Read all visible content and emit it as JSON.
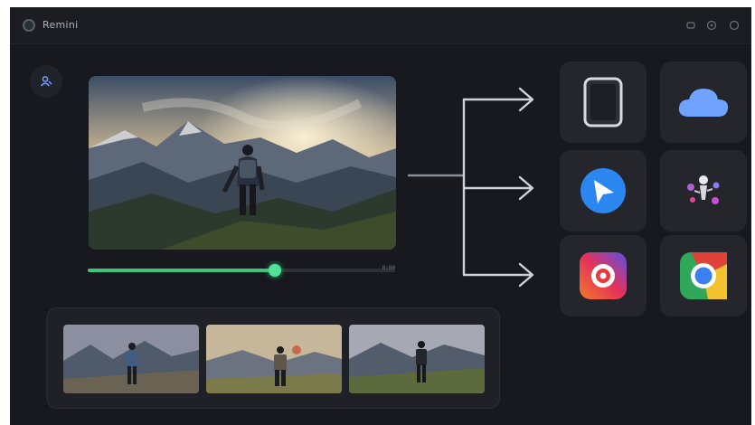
{
  "app": {
    "title": "Remini",
    "logo_icon": "app-logo-icon"
  },
  "titlebar": {
    "buttons": [
      {
        "name": "minimize-icon"
      },
      {
        "name": "help-icon"
      },
      {
        "name": "close-icon"
      }
    ]
  },
  "sidebar": {
    "button_icon": "user-icon"
  },
  "player": {
    "progress": 0.61,
    "time_label": "0:00"
  },
  "destinations": [
    {
      "name": "tablet-icon"
    },
    {
      "name": "cloud-icon"
    },
    {
      "name": "send-app-icon"
    },
    {
      "name": "sparkle-app-icon"
    },
    {
      "name": "camera-app-icon"
    },
    {
      "name": "chrome-icon"
    }
  ],
  "filmstrip": {
    "thumbnails": [
      {
        "name": "thumbnail-1"
      },
      {
        "name": "thumbnail-2"
      },
      {
        "name": "thumbnail-3"
      }
    ]
  },
  "colors": {
    "background": "#17191e",
    "accent": "#3cc67d",
    "tile": "#24262c"
  }
}
